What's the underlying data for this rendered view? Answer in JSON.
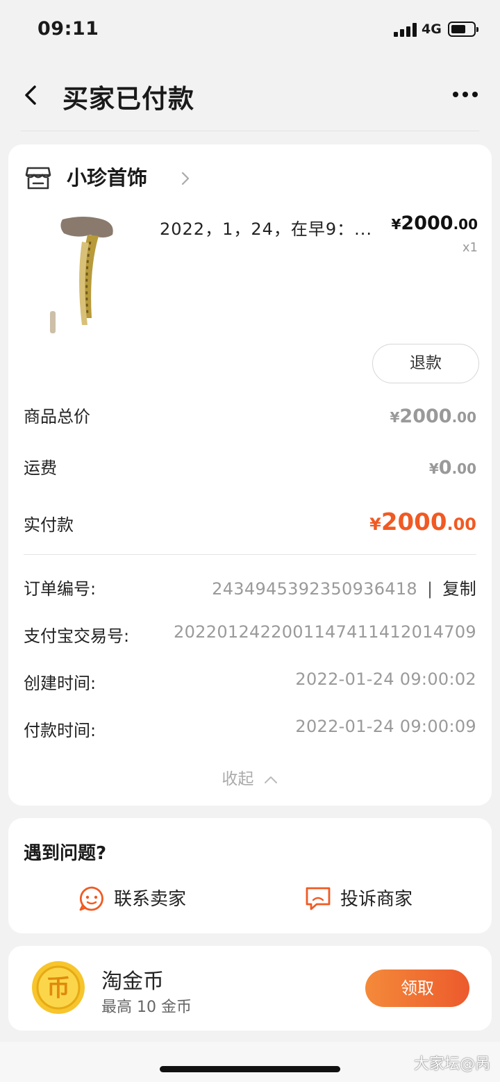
{
  "status_bar": {
    "time": "09:11",
    "network": "4G"
  },
  "header": {
    "title": "买家已付款"
  },
  "shop": {
    "name": "小珍首饰"
  },
  "product": {
    "title": "2022，1，24，在早9：...",
    "price_symbol": "¥",
    "price_int": "2000",
    "price_dec": ".00",
    "qty": "x1"
  },
  "actions": {
    "refund_label": "退款"
  },
  "summary": {
    "total_label": "商品总价",
    "total_symbol": "¥",
    "total_int": "2000",
    "total_dec": ".00",
    "shipping_label": "运费",
    "shipping_symbol": "¥",
    "shipping_int": "0",
    "shipping_dec": ".00",
    "paid_label": "实付款",
    "paid_symbol": "¥",
    "paid_int": "2000",
    "paid_dec": ".00"
  },
  "info": {
    "order_no_label": "订单编号:",
    "order_no_value": "2434945392350936418",
    "order_no_sep": "|",
    "copy_label": "复制",
    "alipay_no_label": "支付宝交易号:",
    "alipay_no_value": "2022012422001147411412014709",
    "created_label": "创建时间:",
    "created_value": "2022-01-24 09:00:02",
    "paid_time_label": "付款时间:",
    "paid_time_value": "2022-01-24 09:00:09",
    "collapse_label": "收起"
  },
  "help": {
    "title": "遇到问题?",
    "contact_label": "联系卖家",
    "complain_label": "投诉商家"
  },
  "coins": {
    "title": "淘金币",
    "subtitle": "最高 10 金币",
    "claim_label": "领取",
    "coin_glyph": "币"
  },
  "watermark": "大家坛@呙",
  "colors": {
    "accent": "#f05a23",
    "button_gradient": [
      "#f48a3a",
      "#ec5a2c"
    ]
  }
}
